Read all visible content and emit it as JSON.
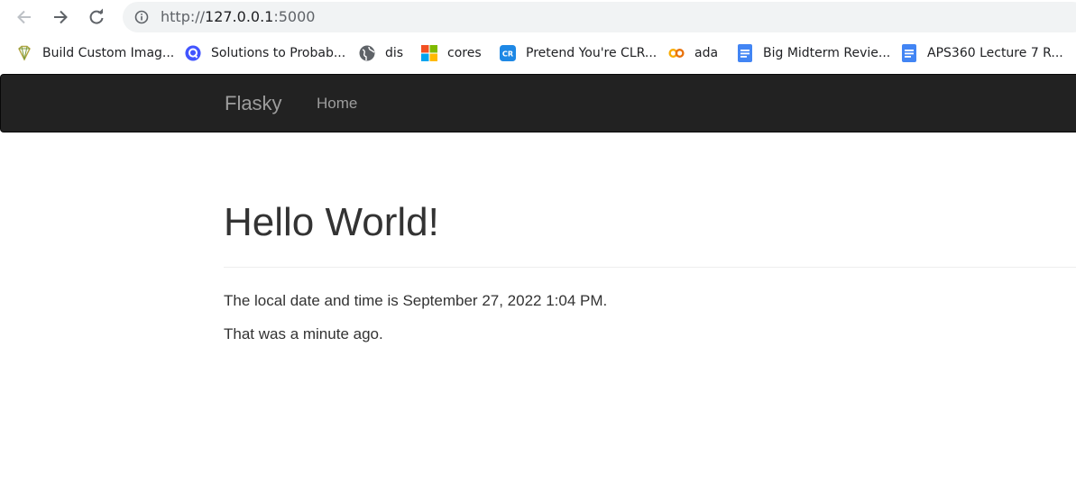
{
  "browser": {
    "address_bar": {
      "scheme": "http://",
      "host": "127.0.0.1",
      "port": ":5000"
    },
    "bookmarks": [
      {
        "label": "Build Custom Imag...",
        "icon": "gem-icon"
      },
      {
        "label": "Solutions to Probab...",
        "icon": "quizlet-icon"
      },
      {
        "label": "dis",
        "icon": "globe-icon"
      },
      {
        "label": "cores",
        "icon": "microsoft-icon"
      },
      {
        "label": "Pretend You're CLR...",
        "icon": "codingrooms-icon"
      },
      {
        "label": "ada",
        "icon": "colab-icon"
      },
      {
        "label": "Big Midterm Revie...",
        "icon": "google-docs-icon"
      },
      {
        "label": "APS360 Lecture 7 R...",
        "icon": "google-docs-icon"
      }
    ]
  },
  "navbar": {
    "brand": "Flasky",
    "links": [
      "Home"
    ]
  },
  "page": {
    "title": "Hello World!",
    "line1": "The local date and time is September 27, 2022 1:04 PM.",
    "line2": "That was a minute ago."
  },
  "colors": {
    "navbar_bg": "#222222",
    "navbar_text": "#9d9d9d",
    "body_text": "#333333",
    "omnibox_bg": "#f1f3f4"
  }
}
